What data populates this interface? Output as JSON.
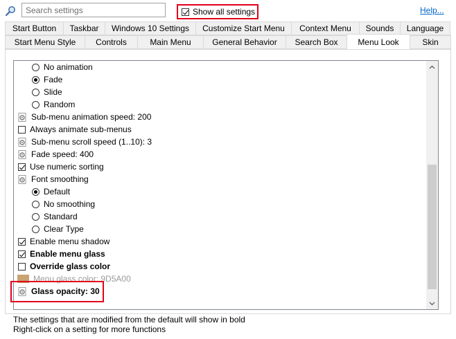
{
  "search": {
    "placeholder": "Search settings"
  },
  "show_all": {
    "label": "Show all settings",
    "checked": true
  },
  "help_link": "Help...",
  "tabs_row1": [
    {
      "label": "Start Button",
      "active": false
    },
    {
      "label": "Taskbar",
      "active": false
    },
    {
      "label": "Windows 10 Settings",
      "active": false
    },
    {
      "label": "Customize Start Menu",
      "active": false
    },
    {
      "label": "Context Menu",
      "active": false
    },
    {
      "label": "Sounds",
      "active": false
    },
    {
      "label": "Language",
      "active": false
    }
  ],
  "tabs_row2": [
    {
      "label": "Start Menu Style",
      "active": false
    },
    {
      "label": "Controls",
      "active": false
    },
    {
      "label": "Main Menu",
      "active": false
    },
    {
      "label": "General Behavior",
      "active": false
    },
    {
      "label": "Search Box",
      "active": false
    },
    {
      "label": "Menu Look",
      "active": true
    },
    {
      "label": "Skin",
      "active": false
    }
  ],
  "settings": [
    {
      "type": "radio",
      "label": "No animation",
      "checked": false,
      "indent": 1
    },
    {
      "type": "radio",
      "label": "Fade",
      "checked": true,
      "indent": 1
    },
    {
      "type": "radio",
      "label": "Slide",
      "checked": false,
      "indent": 1
    },
    {
      "type": "radio",
      "label": "Random",
      "checked": false,
      "indent": 1
    },
    {
      "type": "gear",
      "label": "Sub-menu animation speed: 200",
      "indent": 0
    },
    {
      "type": "checkbox",
      "label": "Always animate sub-menus",
      "checked": false,
      "indent": 0
    },
    {
      "type": "gear",
      "label": "Sub-menu scroll speed (1..10): 3",
      "indent": 0
    },
    {
      "type": "gear",
      "label": "Fade speed: 400",
      "indent": 0
    },
    {
      "type": "checkbox",
      "label": "Use numeric sorting",
      "checked": true,
      "indent": 0
    },
    {
      "type": "gear",
      "label": "Font smoothing",
      "indent": 0
    },
    {
      "type": "radio",
      "label": "Default",
      "checked": true,
      "indent": 1
    },
    {
      "type": "radio",
      "label": "No smoothing",
      "checked": false,
      "indent": 1
    },
    {
      "type": "radio",
      "label": "Standard",
      "checked": false,
      "indent": 1
    },
    {
      "type": "radio",
      "label": "Clear Type",
      "checked": false,
      "indent": 1
    },
    {
      "type": "checkbox",
      "label": "Enable menu shadow",
      "checked": true,
      "indent": 0
    },
    {
      "type": "checkbox",
      "label": "Enable menu glass",
      "checked": true,
      "bold": true,
      "indent": 0
    },
    {
      "type": "checkbox",
      "label": "Override glass color",
      "checked": false,
      "bold": true,
      "indent": 0
    },
    {
      "type": "color",
      "label": "Menu glass color: 9D5A00",
      "disabled": true,
      "indent": 0
    },
    {
      "type": "gear",
      "label": "Glass opacity: 30",
      "bold": true,
      "indent": 0
    }
  ],
  "footer": {
    "line1": "The settings that are modified from the default will show in bold",
    "line2": "Right-click on a setting for more functions"
  },
  "colors": {
    "highlight": "#e2001a",
    "glass_color": "#9D5A00",
    "link": "#0066cc"
  }
}
